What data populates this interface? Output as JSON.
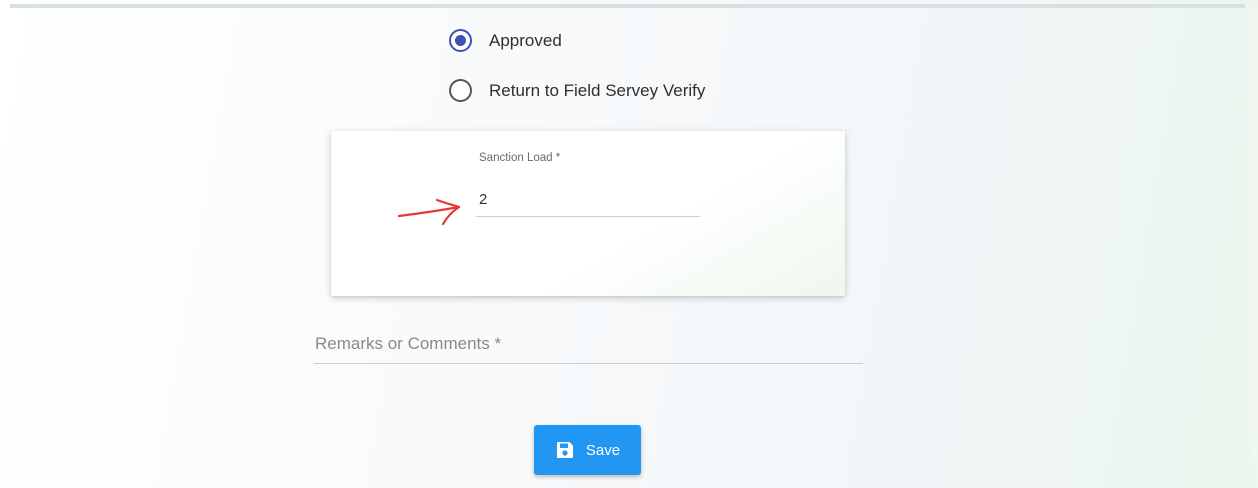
{
  "options": [
    {
      "label": "Approved",
      "checked": true
    },
    {
      "label": "Return to Field Servey Verify",
      "checked": false
    }
  ],
  "sanction_load": {
    "label": "Sanction Load *",
    "value": "2"
  },
  "remarks": {
    "label": "Remarks or Comments *"
  },
  "save_button": {
    "label": "Save",
    "icon": "floppy-disk-icon"
  },
  "colors": {
    "radio_accent": "#3f51b5",
    "button": "#2196f3",
    "annotation_arrow": "#e53935"
  }
}
